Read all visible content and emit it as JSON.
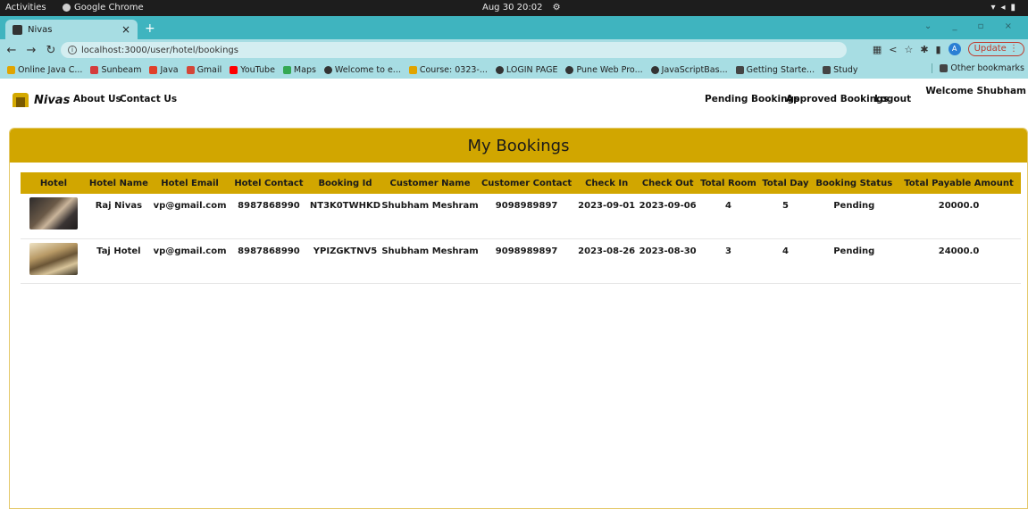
{
  "os": {
    "activities": "Activities",
    "app_name": "Google Chrome",
    "clock": "Aug 30  20:02"
  },
  "browser": {
    "tab_title": "Nivas",
    "url": "localhost:3000/user/hotel/bookings",
    "update_label": "Update",
    "avatar_letter": "A",
    "bookmarks": [
      {
        "label": "Online Java C...",
        "color": "#e0a400"
      },
      {
        "label": "Sunbeam",
        "color": "#d43b3b"
      },
      {
        "label": "Java",
        "color": "#e0402a"
      },
      {
        "label": "Gmail",
        "color": "#d44638"
      },
      {
        "label": "YouTube",
        "color": "#ff0000"
      },
      {
        "label": "Maps",
        "color": "#34a853"
      },
      {
        "label": "Welcome to e...",
        "color": "#333333"
      },
      {
        "label": "Course: 0323-...",
        "color": "#e0a400"
      },
      {
        "label": "LOGIN PAGE",
        "color": "#333333"
      },
      {
        "label": "Pune Web Pro...",
        "color": "#333333"
      },
      {
        "label": "JavaScriptBas...",
        "color": "#333333"
      },
      {
        "label": "Getting Starte...",
        "color": "#444444"
      },
      {
        "label": "Study",
        "color": "#444444"
      }
    ],
    "other_bookmarks": "Other bookmarks"
  },
  "navbar": {
    "brand": "Nivas",
    "about": "About Us",
    "contact": "Contact Us",
    "pending": "Pending Bookings",
    "approved": "Approved Bookings",
    "logout": "Logout",
    "welcome": "Welcome Shubham"
  },
  "bookings": {
    "title": "My Bookings",
    "headers": [
      "Hotel",
      "Hotel Name",
      "Hotel Email",
      "Hotel Contact",
      "Booking Id",
      "Customer Name",
      "Customer Contact",
      "Check In",
      "Check Out",
      "Total Room",
      "Total Day",
      "Booking Status",
      "Total Payable Amount"
    ],
    "rows": [
      {
        "hotel_name": "Raj Nivas",
        "email": "vp@gmail.com",
        "contact": "8987868990",
        "booking_id": "NT3K0TWHKD",
        "customer": "Shubham Meshram",
        "customer_contact": "9098989897",
        "check_in": "2023-09-01",
        "check_out": "2023-09-06",
        "rooms": "4",
        "days": "5",
        "status": "Pending",
        "amount": "20000.0"
      },
      {
        "hotel_name": "Taj Hotel",
        "email": "vp@gmail.com",
        "contact": "8987868990",
        "booking_id": "YPIZGKTNV5",
        "customer": "Shubham Meshram",
        "customer_contact": "9098989897",
        "check_in": "2023-08-26",
        "check_out": "2023-08-30",
        "rooms": "3",
        "days": "4",
        "status": "Pending",
        "amount": "24000.0"
      }
    ]
  }
}
